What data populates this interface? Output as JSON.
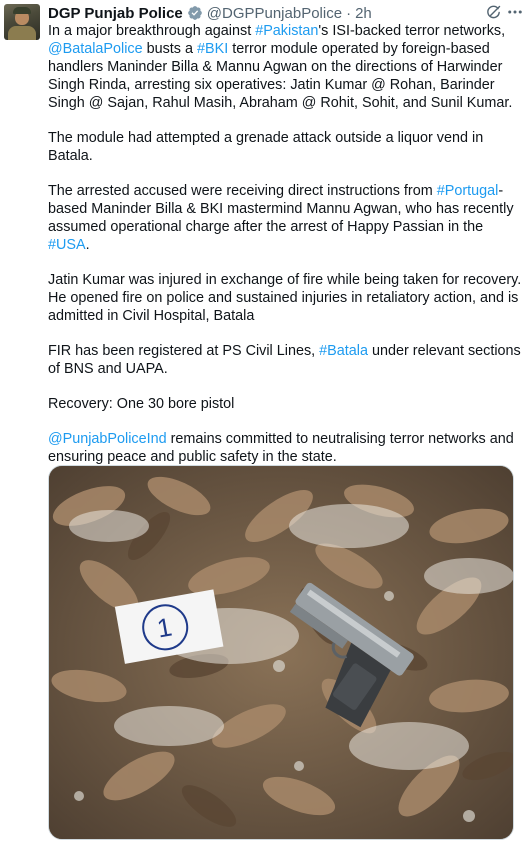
{
  "author": {
    "name": "DGP Punjab Police",
    "handle": "@DGPPunjabPolice",
    "separator": "·",
    "time": "2h",
    "verified": true
  },
  "icons": {
    "grok": "grok-icon",
    "more": "more-icon",
    "verified": "verified-badge-icon"
  },
  "colors": {
    "link": "#1d9bf0",
    "text": "#0f1419",
    "muted": "#536471",
    "verified_fill": "#829aab"
  },
  "tweet": {
    "p1": {
      "t1": "In a major breakthrough against ",
      "l1": "#Pakistan",
      "t2": "'s ISI-backed terror networks, ",
      "l2": "@BatalaPolice",
      "t3": " busts a ",
      "l3": "#BKI",
      "t4": " terror module operated by foreign-based handlers Maninder Billa & Mannu Agwan on the directions of Harwinder Singh Rinda, arresting six operatives: Jatin Kumar @ Rohan, Barinder Singh @ Sajan, Rahul Masih, Abraham @ Rohit, Sohit, and Sunil Kumar."
    },
    "p2": "The module had attempted a grenade attack outside a liquor vend in Batala.",
    "p3": {
      "t1": "The arrested accused were receiving direct instructions from ",
      "l1": "#Portugal",
      "t2": "-based Maninder Billa & BKI mastermind Mannu Agwan, who has recently assumed operational charge after the arrest of Happy Passian in the ",
      "l2": "#USA",
      "t3": "."
    },
    "p4": "Jatin Kumar was injured in exchange of fire while being taken for recovery. He opened fire on police and sustained injuries in retaliatory action, and is admitted in Civil Hospital, Batala",
    "p5": {
      "t1": "FIR has been registered at PS Civil Lines, ",
      "l1": "#Batala",
      "t2": " under relevant sections of BNS and UAPA."
    },
    "p6": "Recovery: One 30 bore pistol",
    "p7": {
      "l1": "@PunjabPoliceInd",
      "t1": " remains committed to neutralising terror networks and ensuring peace and public safety in the state."
    }
  },
  "media": {
    "evidence_label": "1"
  }
}
